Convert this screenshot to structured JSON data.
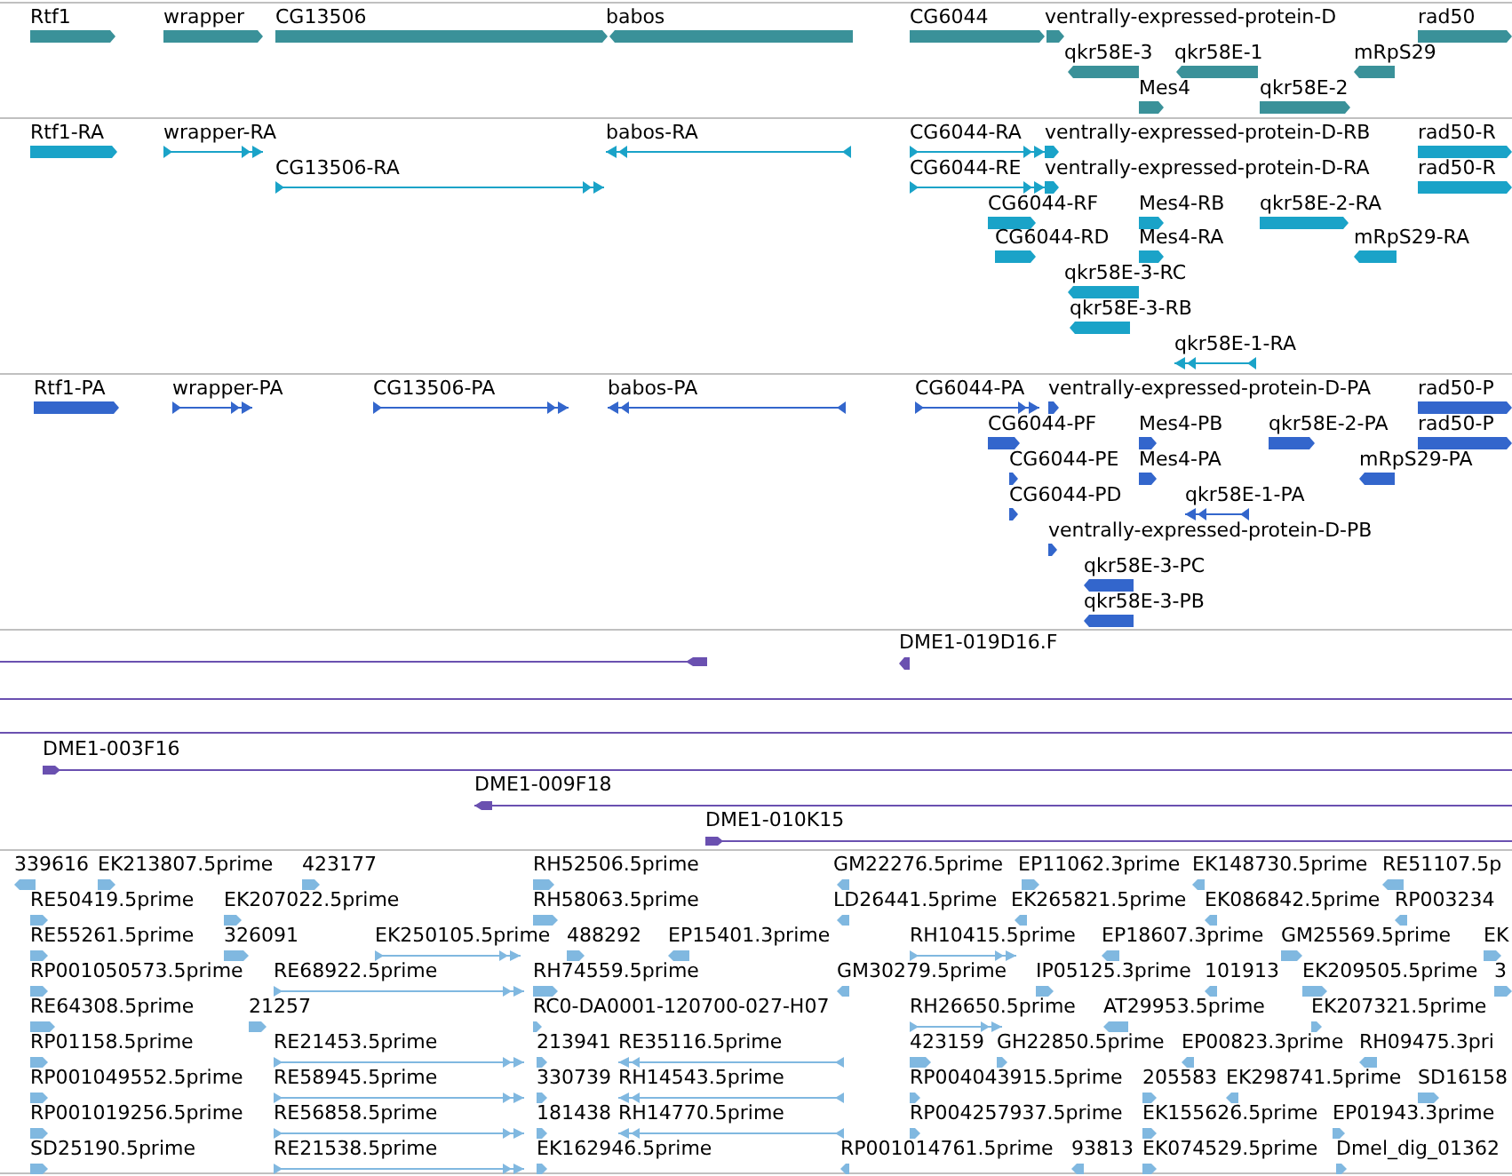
{
  "tracks": [
    {
      "kind": "gene",
      "color": "#3a9199",
      "features": [
        {
          "label": "Rtf1"
        },
        {
          "label": "wrapper"
        },
        {
          "label": "CG13506"
        },
        {
          "label": "babos"
        },
        {
          "label": "CG6044"
        },
        {
          "label": "ventrally-expressed-protein-D"
        },
        {
          "label": "rad50"
        },
        {
          "label": "qkr58E-3"
        },
        {
          "label": "qkr58E-1"
        },
        {
          "label": "mRpS29"
        },
        {
          "label": "Mes4"
        },
        {
          "label": "qkr58E-2"
        }
      ]
    },
    {
      "kind": "transcript",
      "color": "#1aa3c8",
      "features": [
        {
          "label": "Rtf1-RA"
        },
        {
          "label": "wrapper-RA"
        },
        {
          "label": "babos-RA"
        },
        {
          "label": "CG6044-RA"
        },
        {
          "label": "ventrally-expressed-protein-D-RB"
        },
        {
          "label": "rad50-R"
        },
        {
          "label": "CG13506-RA"
        },
        {
          "label": "CG6044-RE"
        },
        {
          "label": "ventrally-expressed-protein-D-RA"
        },
        {
          "label": "rad50-R"
        },
        {
          "label": "CG6044-RF"
        },
        {
          "label": "Mes4-RB"
        },
        {
          "label": "qkr58E-2-RA"
        },
        {
          "label": "CG6044-RD"
        },
        {
          "label": "Mes4-RA"
        },
        {
          "label": "mRpS29-RA"
        },
        {
          "label": "qkr58E-3-RC"
        },
        {
          "label": "qkr58E-3-RB"
        },
        {
          "label": "qkr58E-1-RA"
        }
      ]
    },
    {
      "kind": "protein",
      "color": "#3366cc",
      "features": [
        {
          "label": "Rtf1-PA"
        },
        {
          "label": "wrapper-PA"
        },
        {
          "label": "CG13506-PA"
        },
        {
          "label": "babos-PA"
        },
        {
          "label": "CG6044-PA"
        },
        {
          "label": "ventrally-expressed-protein-D-PA"
        },
        {
          "label": "rad50-P"
        },
        {
          "label": "CG6044-PF"
        },
        {
          "label": "Mes4-PB"
        },
        {
          "label": "qkr58E-2-PA"
        },
        {
          "label": "rad50-P"
        },
        {
          "label": "CG6044-PE"
        },
        {
          "label": "Mes4-PA"
        },
        {
          "label": "mRpS29-PA"
        },
        {
          "label": "CG6044-PD"
        },
        {
          "label": "qkr58E-1-PA"
        },
        {
          "label": "ventrally-expressed-protein-D-PB"
        },
        {
          "label": "qkr58E-3-PC"
        },
        {
          "label": "qkr58E-3-PB"
        }
      ]
    },
    {
      "kind": "clone",
      "color": "#6a50b0",
      "features": [
        {
          "label": "DME1-019D16.F"
        },
        {
          "label": "DME1-003F16"
        },
        {
          "label": "DME1-009F18"
        },
        {
          "label": "DME1-010K15"
        }
      ]
    },
    {
      "kind": "est",
      "color": "#80b8e0",
      "features": [
        {
          "label": "339616"
        },
        {
          "label": "EK213807.5prime"
        },
        {
          "label": "423177"
        },
        {
          "label": "RH52506.5prime"
        },
        {
          "label": "GM22276.5prime"
        },
        {
          "label": "EP11062.3prime"
        },
        {
          "label": "EK148730.5prime"
        },
        {
          "label": "RE51107.5p"
        },
        {
          "label": "RE50419.5prime"
        },
        {
          "label": "EK207022.5prime"
        },
        {
          "label": "RH58063.5prime"
        },
        {
          "label": "LD26441.5prime"
        },
        {
          "label": "EK265821.5prime"
        },
        {
          "label": "EK086842.5prime"
        },
        {
          "label": "RP003234"
        },
        {
          "label": "RE55261.5prime"
        },
        {
          "label": "326091"
        },
        {
          "label": "EK250105.5prime"
        },
        {
          "label": "488292"
        },
        {
          "label": "EP15401.3prime"
        },
        {
          "label": "RH10415.5prime"
        },
        {
          "label": "EP18607.3prime"
        },
        {
          "label": "GM25569.5prime"
        },
        {
          "label": "EK"
        },
        {
          "label": "RP001050573.5prime"
        },
        {
          "label": "RE68922.5prime"
        },
        {
          "label": "RH74559.5prime"
        },
        {
          "label": "GM30279.5prime"
        },
        {
          "label": "IP05125.3prime"
        },
        {
          "label": "101913"
        },
        {
          "label": "EK209505.5prime"
        },
        {
          "label": "3"
        },
        {
          "label": "RE64308.5prime"
        },
        {
          "label": "21257"
        },
        {
          "label": "RC0-DA0001-120700-027-H07"
        },
        {
          "label": "RH26650.5prime"
        },
        {
          "label": "AT29953.5prime"
        },
        {
          "label": "EK207321.5prime"
        },
        {
          "label": "RP01158.5prime"
        },
        {
          "label": "RE21453.5prime"
        },
        {
          "label": "213941"
        },
        {
          "label": "RE35116.5prime"
        },
        {
          "label": "423159"
        },
        {
          "label": "GH22850.5prime"
        },
        {
          "label": "EP00823.3prime"
        },
        {
          "label": "RH09475.3pri"
        },
        {
          "label": "RP001049552.5prime"
        },
        {
          "label": "RE58945.5prime"
        },
        {
          "label": "330739"
        },
        {
          "label": "RH14543.5prime"
        },
        {
          "label": "RP004043915.5prime"
        },
        {
          "label": "205583"
        },
        {
          "label": "EK298741.5prime"
        },
        {
          "label": "SD16158"
        },
        {
          "label": "RP001019256.5prime"
        },
        {
          "label": "RE56858.5prime"
        },
        {
          "label": "181438"
        },
        {
          "label": "RH14770.5prime"
        },
        {
          "label": "RP004257937.5prime"
        },
        {
          "label": "EK155626.5prime"
        },
        {
          "label": "EP01943.3prime"
        },
        {
          "label": "SD25190.5prime"
        },
        {
          "label": "RE21538.5prime"
        },
        {
          "label": "EK162946.5prime"
        },
        {
          "label": "RP001014761.5prime"
        },
        {
          "label": "93813"
        },
        {
          "label": "EK074529.5prime"
        },
        {
          "label": "Dmel_dig_01362"
        }
      ]
    }
  ]
}
